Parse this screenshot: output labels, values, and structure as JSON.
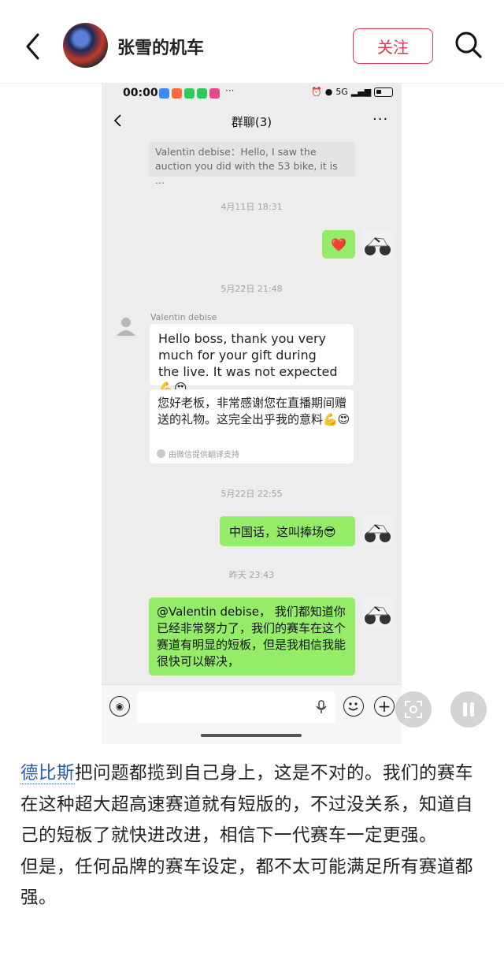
{
  "header": {
    "author": "张雪的机车",
    "follow_label": "关注"
  },
  "screenshot": {
    "status_bar": {
      "time": "00:00",
      "more": "···",
      "network": "5G"
    },
    "chat_title": "群聊(3)",
    "chat_menu": "···",
    "quote_text": "Valentin debise：Hello, I saw the auction you did with the 53 bike, it is ...",
    "timestamps": [
      "4月11日 18:31",
      "5月22日 21:48",
      "5月22日 22:55",
      "昨天 23:43"
    ],
    "messages": [
      {
        "from": "me",
        "text": "❤️"
      },
      {
        "from": "Valentin debise",
        "text": "Hello boss, thank you very much for your gift during the live. It was not expected 💪😍",
        "translation": "您好老板，非常感谢您在直播期间赠送的礼物。这完全出乎我的意料💪😍",
        "translation_note": "由微信提供翻译支持"
      },
      {
        "from": "me",
        "text": "中国话，这叫捧场😎"
      },
      {
        "from": "me",
        "text": "@Valentin debise， 我们都知道你已经非常努力了，我们的赛车在这个赛道有明显的短板，但是我相信我能很快可以解决，"
      }
    ],
    "sender_name": "Valentin debise"
  },
  "body": {
    "mention": "德比斯",
    "text_1": "把问题都揽到自己身上，这是不对的。我们的赛车在这种超大超高速赛道就有短版的，不过没关系，知道自己的短板了就快进改进，相信下一代赛车一定更强。",
    "text_2": "但是，任何品牌的赛车设定，都不太可能满足所有赛道都强。"
  },
  "colors": {
    "accent": "#e0394a",
    "wechat_green": "#95ec69",
    "mention": "#2a5ea8"
  },
  "icons": [
    "back-arrow-icon",
    "search-icon",
    "voice-icon",
    "mic-icon",
    "emoji-icon",
    "plus-icon",
    "scan-icon",
    "pause-icon"
  ]
}
